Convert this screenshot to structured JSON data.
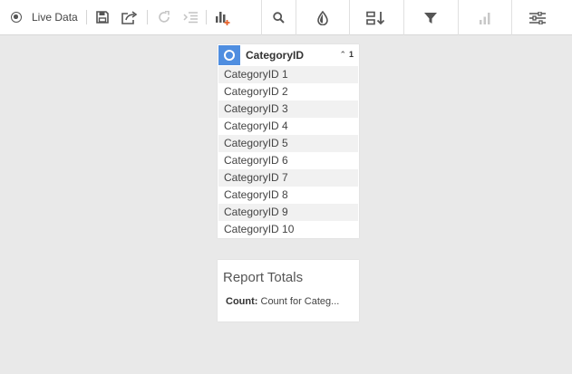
{
  "toolbar": {
    "live_data_label": "Live Data",
    "icons": {
      "live": "radio-target-icon",
      "save": "save-icon",
      "share": "share-export-icon",
      "redo": "redo-icon",
      "indent": "indent-list-icon",
      "add_chart": "add-chart-icon",
      "search": "search-icon",
      "color": "color-drop-icon",
      "sort": "sort-icon",
      "filter": "filter-icon",
      "chart": "bar-chart-icon",
      "settings": "sliders-settings-icon"
    }
  },
  "field": {
    "title": "CategoryID",
    "sort_order": "1",
    "sort_direction": "ascending",
    "rows": [
      "CategoryID 1",
      "CategoryID 2",
      "CategoryID 3",
      "CategoryID 4",
      "CategoryID 5",
      "CategoryID 6",
      "CategoryID 7",
      "CategoryID 8",
      "CategoryID 9",
      "CategoryID 10"
    ]
  },
  "totals": {
    "title": "Report Totals",
    "count_label": "Count:",
    "count_value": "Count for Categ..."
  },
  "colors": {
    "accent_blue": "#4f8ee0",
    "add_orange": "#e8632b",
    "background": "#e9e9e9"
  }
}
